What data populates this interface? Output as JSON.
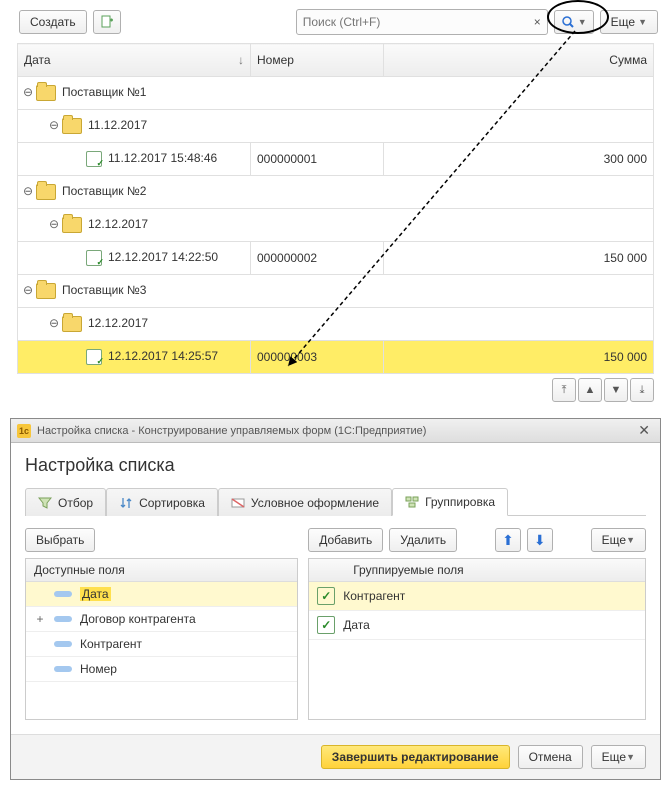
{
  "toolbar": {
    "create": "Создать",
    "searchPlaceholder": "Поиск (Ctrl+F)",
    "more": "Еще"
  },
  "columns": {
    "date": "Дата",
    "number": "Номер",
    "sum": "Сумма"
  },
  "rows": [
    {
      "type": "grp",
      "lvl": 0,
      "text": "Поставщик №1"
    },
    {
      "type": "grp",
      "lvl": 1,
      "text": "11.12.2017"
    },
    {
      "type": "doc",
      "lvl": 2,
      "date": "11.12.2017 15:48:46",
      "num": "000000001",
      "sum": "300 000"
    },
    {
      "type": "grp",
      "lvl": 0,
      "text": "Поставщик №2"
    },
    {
      "type": "grp",
      "lvl": 1,
      "text": "12.12.2017"
    },
    {
      "type": "doc",
      "lvl": 2,
      "date": "12.12.2017 14:22:50",
      "num": "000000002",
      "sum": "150 000"
    },
    {
      "type": "grp",
      "lvl": 0,
      "text": "Поставщик №3"
    },
    {
      "type": "grp",
      "lvl": 1,
      "text": "12.12.2017"
    },
    {
      "type": "doc",
      "lvl": 2,
      "sel": true,
      "date": "12.12.2017 14:25:57",
      "num": "000000003",
      "sum": "150 000"
    }
  ],
  "dialog": {
    "title": "Настройка списка - Конструирование управляемых форм  (1С:Предприятие)",
    "heading": "Настройка списка"
  },
  "tabs": {
    "filter": "Отбор",
    "sort": "Сортировка",
    "cond": "Условное оформление",
    "group": "Группировка"
  },
  "leftPanel": {
    "choose": "Выбрать",
    "head": "Доступные поля",
    "items": [
      {
        "exp": "",
        "label": "Дата",
        "hl": true
      },
      {
        "exp": "+",
        "label": "Договор контрагента"
      },
      {
        "exp": "",
        "label": "Контрагент"
      },
      {
        "exp": "",
        "label": "Номер"
      }
    ]
  },
  "rightPanel": {
    "add": "Добавить",
    "del": "Удалить",
    "more": "Еще",
    "head": "Группируемые поля",
    "items": [
      {
        "label": "Контрагент",
        "hl": true
      },
      {
        "label": "Дата"
      }
    ]
  },
  "footer": {
    "finish": "Завершить редактирование",
    "cancel": "Отмена",
    "more": "Еще"
  }
}
